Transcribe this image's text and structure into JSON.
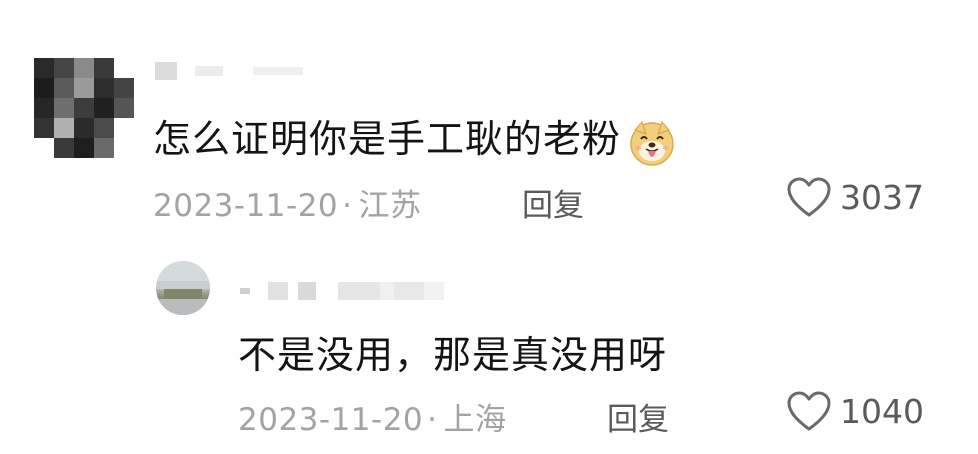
{
  "comments": [
    {
      "text": "怎么证明你是手工耿的老粉",
      "emoji": "dog-face-tongue-out",
      "date": "2023-11-20",
      "separator": "·",
      "location": "江苏",
      "reply_label": "回复",
      "likes": "3037",
      "avatar": "pixelated-avatar",
      "username_obscured": true
    },
    {
      "text": "不是没用，那是真没用呀",
      "date": "2023-11-20",
      "separator": "·",
      "location": "上海",
      "reply_label": "回复",
      "likes": "1040",
      "avatar": "round-landscape-avatar",
      "username_obscured": true,
      "is_reply": true
    }
  ],
  "colors": {
    "text": "#141414",
    "meta": "#a3a3a3",
    "action": "#5a5a5a",
    "background": "#ffffff"
  }
}
